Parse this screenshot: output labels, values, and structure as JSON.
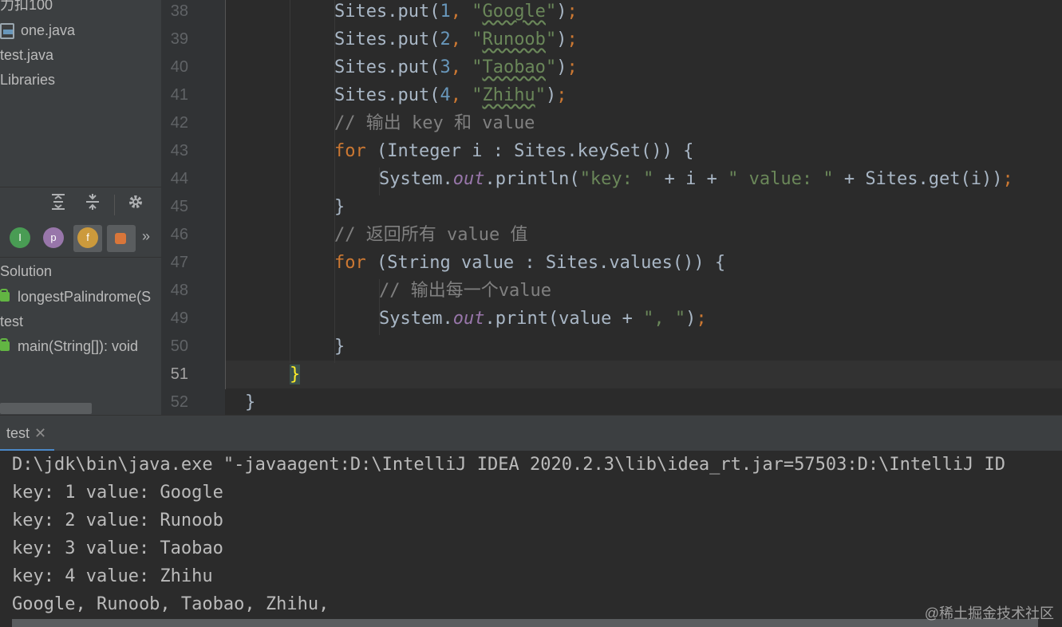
{
  "project_tree": {
    "items": [
      {
        "label": "力扣100",
        "icon": "folder-icon"
      },
      {
        "label": "one.java",
        "icon": "java-file-icon"
      },
      {
        "label": "test.java",
        "icon": "java-file-icon"
      },
      {
        "label": "Libraries",
        "icon": "library-icon"
      }
    ]
  },
  "structure_toolbar": {
    "expand_all_icon": "expand-all-icon",
    "collapse_all_icon": "collapse-all-icon",
    "settings_icon": "gear-icon",
    "filters": [
      {
        "name": "inherited-filter",
        "label": "I"
      },
      {
        "name": "properties-filter",
        "label": "p"
      },
      {
        "name": "fields-filter",
        "label": "f"
      },
      {
        "name": "non-public-filter",
        "label": ""
      }
    ],
    "more_label": "»"
  },
  "structure": {
    "items": [
      {
        "label": "Solution",
        "kind": "class"
      },
      {
        "label": "longestPalindrome(S",
        "kind": "method"
      },
      {
        "label": "test",
        "kind": "class"
      },
      {
        "label": "main(String[]): void",
        "kind": "method"
      }
    ]
  },
  "editor": {
    "line_numbers": [
      "38",
      "39",
      "40",
      "41",
      "42",
      "43",
      "44",
      "45",
      "46",
      "47",
      "48",
      "49",
      "50",
      "51",
      "52"
    ],
    "current_line": "51"
  },
  "run_window": {
    "tab_label": "test",
    "close_icon": "close-icon",
    "output": [
      "D:\\jdk\\bin\\java.exe \"-javaagent:D:\\IntelliJ IDEA 2020.2.3\\lib\\idea_rt.jar=57503:D:\\IntelliJ ID",
      "key: 1 value: Google",
      "key: 2 value: Runoob",
      "key: 3 value: Taobao",
      "key: 4 value: Zhihu",
      "Google, Runoob, Taobao, Zhihu,"
    ]
  },
  "watermark": "@稀土掘金技术社区",
  "colors": {
    "keyword": "#cc7832",
    "string": "#6a8759",
    "number": "#6897bb",
    "comment": "#808080",
    "field": "#9876aa",
    "text": "#a9b7c6"
  }
}
